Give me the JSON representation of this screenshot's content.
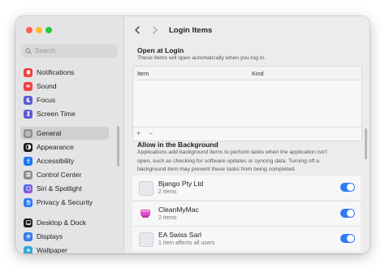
{
  "window": {
    "title": "Login Items"
  },
  "sidebar": {
    "search_placeholder": "Search",
    "items": [
      {
        "label": "Notifications",
        "icon": "bell-icon",
        "color": "#f0413e"
      },
      {
        "label": "Sound",
        "icon": "speaker-icon",
        "color": "#f0413e"
      },
      {
        "label": "Focus",
        "icon": "moon-icon",
        "color": "#5b5ad6"
      },
      {
        "label": "Screen Time",
        "icon": "hourglass-icon",
        "color": "#5b5ad6"
      },
      {
        "label": "General",
        "icon": "gear-icon",
        "color": "#8e8e93"
      },
      {
        "label": "Appearance",
        "icon": "appearance-icon",
        "color": "#1c1c1e"
      },
      {
        "label": "Accessibility",
        "icon": "accessibility-icon",
        "color": "#1878f5"
      },
      {
        "label": "Control Center",
        "icon": "control-center-icon",
        "color": "#8e8e93"
      },
      {
        "label": "Siri & Spotlight",
        "icon": "siri-icon",
        "color": "#2f6ff5"
      },
      {
        "label": "Privacy & Security",
        "icon": "hand-icon",
        "color": "#2f7bf5"
      },
      {
        "label": "Desktop & Dock",
        "icon": "dock-icon",
        "color": "#1c1c1e"
      },
      {
        "label": "Displays",
        "icon": "sun-icon",
        "color": "#2f7bf5"
      },
      {
        "label": "Wallpaper",
        "icon": "wallpaper-icon",
        "color": "#35aadc"
      }
    ],
    "selected": "General"
  },
  "login": {
    "heading": "Open at Login",
    "subtitle": "These items will open automatically when you log in.",
    "col_item": "Item",
    "col_kind": "Kind",
    "add": "+",
    "remove": "−"
  },
  "background": {
    "heading": "Allow in the Background",
    "description_lines": [
      "Applications add background items to perform tasks when the application isn't",
      "open, such as checking for software updates or syncing data. Turning off a",
      "background item may prevent these tasks from being completed."
    ],
    "items": [
      {
        "name": "Bjango Pty Ltd",
        "count": "2 items",
        "enabled": true
      },
      {
        "name": "CleanMyMac",
        "count": "2 items",
        "enabled": true
      },
      {
        "name": "EA Swiss Sarl",
        "count": "1 item affects all users",
        "enabled": true
      }
    ]
  },
  "colors": {
    "accent": "#2f7bf5",
    "cleanmymac": "#e14ecb"
  }
}
